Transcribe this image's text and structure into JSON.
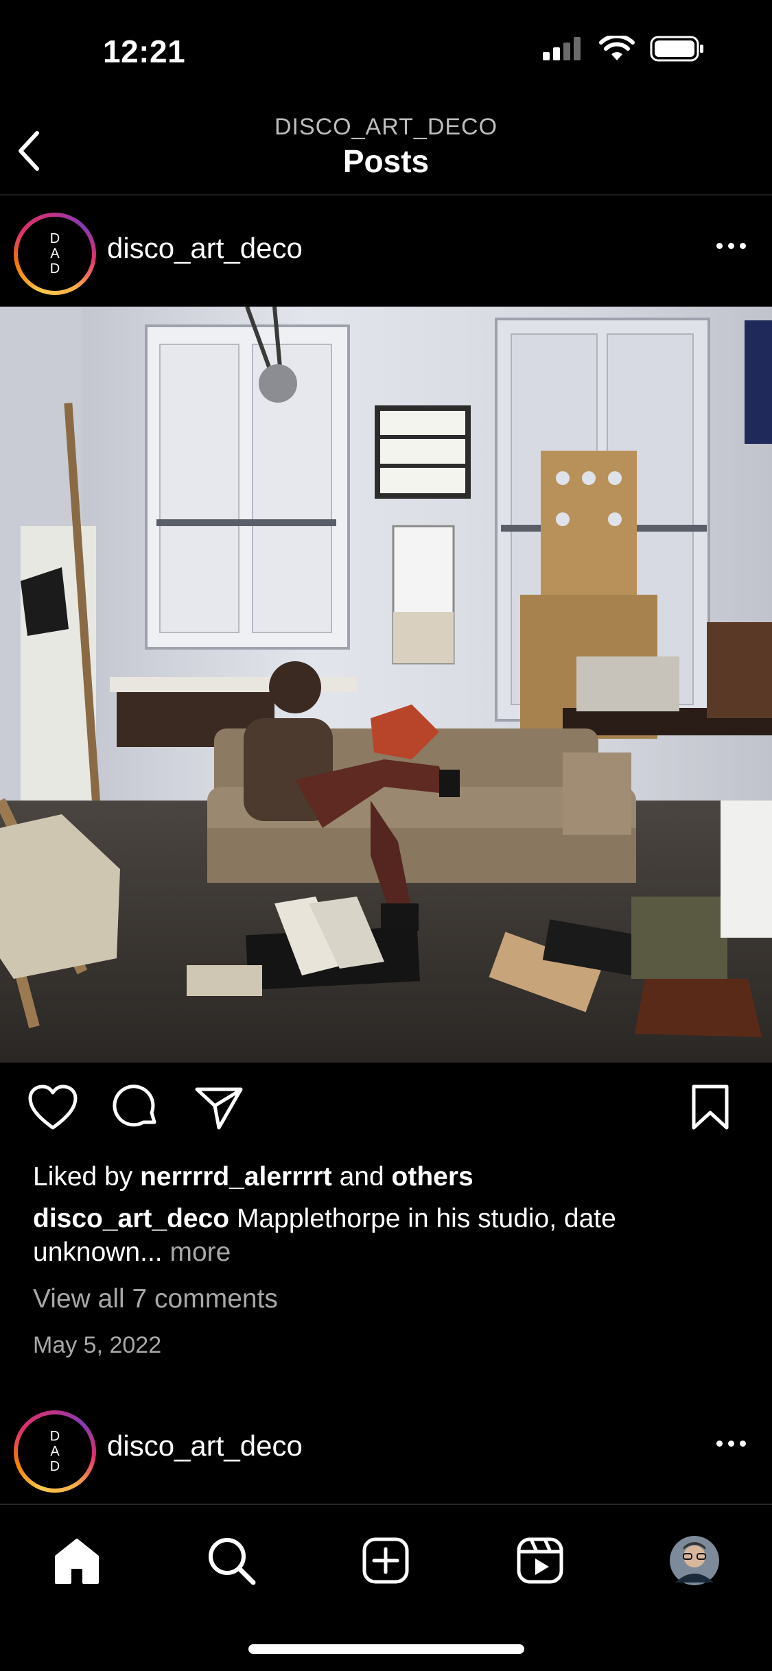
{
  "status_bar": {
    "time": "12:21"
  },
  "header": {
    "account": "DISCO_ART_DECO",
    "title": "Posts"
  },
  "post1": {
    "avatar_letters": [
      "D",
      "A",
      "D"
    ],
    "username": "disco_art_deco",
    "liked_by_prefix": "Liked by",
    "liked_by_user": "nerrrrd_alerrrrt",
    "liked_by_and": "and",
    "liked_by_others": "others",
    "caption_username": "disco_art_deco",
    "caption_line1": "Mapplethorpe in his studio, date",
    "caption_line2": "unknown...",
    "more_label": "more",
    "comments_label": "View all 7 comments",
    "date": "May 5, 2022"
  },
  "post2": {
    "avatar_letters": [
      "D",
      "A",
      "D"
    ],
    "username": "disco_art_deco"
  },
  "icons": {
    "back": "chevron-left-icon",
    "like": "heart-icon",
    "comment": "comment-bubble-icon",
    "share": "paper-plane-icon",
    "save": "bookmark-icon",
    "home": "home-icon",
    "search": "search-icon",
    "create": "plus-square-icon",
    "reels": "reels-icon",
    "profile": "profile-avatar"
  },
  "colors": {
    "background": "#000000",
    "text": "#ffffff",
    "muted": "#a8a8a8",
    "ring_start": "#fcaf45",
    "ring_end": "#833ab4"
  }
}
